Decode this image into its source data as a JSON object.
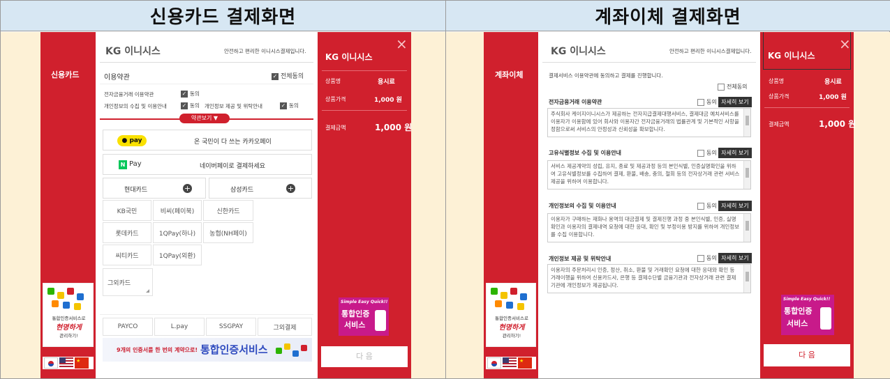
{
  "headers": {
    "left": "신용카드 결제화면",
    "right": "계좌이체 결제화면"
  },
  "left": {
    "side_label": "신용카드",
    "logo": "KG 이니시스",
    "tagline": "안전하고 편리한 이니시스결제입니다.",
    "terms_title": "이용약관",
    "agree_all": "전체동의",
    "term1": "전자금융거래 이용약관",
    "term2": "개인정보의 수집 및 이용안내",
    "term3": "개인정보 제공 및 위탁안내",
    "agree": "동의",
    "view_terms": "약관보기 ▼",
    "kakao_logo": "pay",
    "kakao_text": "온 국민이 다 쓰는 카카오페이",
    "naver_logo": "Pay",
    "naver_text": "네이버페이로 결제하세요",
    "card_hyundai": "현대카드",
    "card_samsung": "삼성카드",
    "cards": [
      "KB국민",
      "비씨(페이북)",
      "신한카드",
      "롯데카드",
      "1QPay(하나)",
      "농협(NH페이)",
      "씨티카드",
      "1QPay(외환)"
    ],
    "card_other": "그외카드",
    "pays": [
      "PAYCO",
      "L.pay",
      "SSGPAY",
      "그외결제"
    ],
    "banner_text": "9개의 인증서를 한 번의 계약으로!",
    "banner_title": "통합인증서비스",
    "promo1": "통합인증서비스로",
    "promo2": "현명하게",
    "promo3": "관리하기!",
    "info_logo": "KG 이니시스",
    "product_key": "상품명",
    "product_val": "용시료",
    "price_key": "상품가격",
    "price_val": "1,000 원",
    "total_key": "결제금액",
    "total_val": "1,000 원",
    "ad_top": "Simple Easy Quick!!",
    "ad_title1": "통합인증",
    "ad_title2": "서비스",
    "next": "다 음",
    "close": "×"
  },
  "right": {
    "side_label": "계좌이체",
    "logo": "KG 이니시스",
    "tagline": "안전하고 편리한 이니시스결제입니다.",
    "intro": "결제서비스 이용약관에 동의하고 결제를 진행합니다.",
    "agree_all": "전체동의",
    "agree": "동의",
    "detail": "자세히 보기",
    "sections": [
      {
        "title": "전자금융거래 이용약관",
        "body": "주식회사 케이지이니시스가 제공하는 전자지급결제대행서비스, 결제대금 예치서비스를 이용자가 이용함에 있어 회사와 이용자간 전자금융거래의 법률관계 및 기본적인 사항을 정함으로써 서비스의 안정성과 신뢰성을 확보합니다."
      },
      {
        "title": "고유식별정보 수집 및 이용안내",
        "body": "서비스 제공계약의 성립, 유지, 종료 및 제공과정 등의 본인식별, 인증실명확인을 위하여 고유식별정보를 수집하여 결제, 환불, 배송, 충의, 철회 등의 전자상거래 관련 서비스 제공을 위하여 이용합니다."
      },
      {
        "title": "개인정보의 수집 및 이용안내",
        "body": "이용자가 구매하는 재화나 용역의 대금결제 및 결제진행 과정 중 본인식별, 인증, 실명확인과 이용자의 결제내역 요청에 대한 응대, 확인 및 부정이용 방지를 위하여 개인정보를 수집 이용합니다."
      },
      {
        "title": "개인정보 제공 및 위탁안내",
        "body": "이용자의 주문처리시 인증, 정산, 취소, 환불 및 거래확인 요청에 대한 응대와 확인 등 거래이행을 위하여 신용카드사, 은행 등 결제수단별 금융기관과 전자상거래 관련 결제기관에 개인정보가 제공됩니다."
      }
    ],
    "promo1": "통합인증서비스로",
    "promo2": "현명하게",
    "promo3": "관리하기!",
    "info_logo": "KG 이니시스",
    "product_key": "상품명",
    "product_val": "용시료",
    "price_key": "상품가격",
    "price_val": "1,000 원",
    "total_key": "결제금액",
    "total_val": "1,000 원",
    "ad_top": "Simple Easy Quick!!",
    "ad_title1": "통합인증",
    "ad_title2": "서비스",
    "next": "다 음",
    "close": "×"
  },
  "colors": {
    "brand_red": "#d0202d",
    "header_bg": "#d7e7f3",
    "panel_bg": "#fdf1d6",
    "kakao_yellow": "#fae100",
    "naver_green": "#03c75a"
  }
}
